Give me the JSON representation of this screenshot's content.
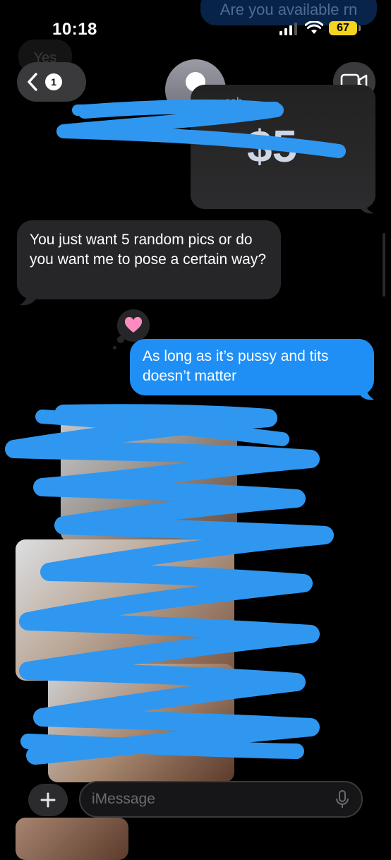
{
  "status_bar": {
    "time": "10:18",
    "battery": "67"
  },
  "background_messages": {
    "previous_outgoing": "Are you available rn",
    "previous_incoming": "Yes"
  },
  "nav": {
    "back_badge": "1"
  },
  "cash_card": {
    "label_fragment": "ash",
    "amount": "$5"
  },
  "messages": {
    "incoming": "You just want 5 random pics or do you want me to pose a certain way?",
    "tapback_icon": "heart",
    "outgoing": "As long as it’s pussy and tits doesn’t matter"
  },
  "input": {
    "placeholder": "iMessage"
  },
  "colors": {
    "accent_blue": "#1f8ff6",
    "incoming_gray": "#262628",
    "scribble_blue": "#2f97f0",
    "battery_yellow": "#f5d31f"
  }
}
